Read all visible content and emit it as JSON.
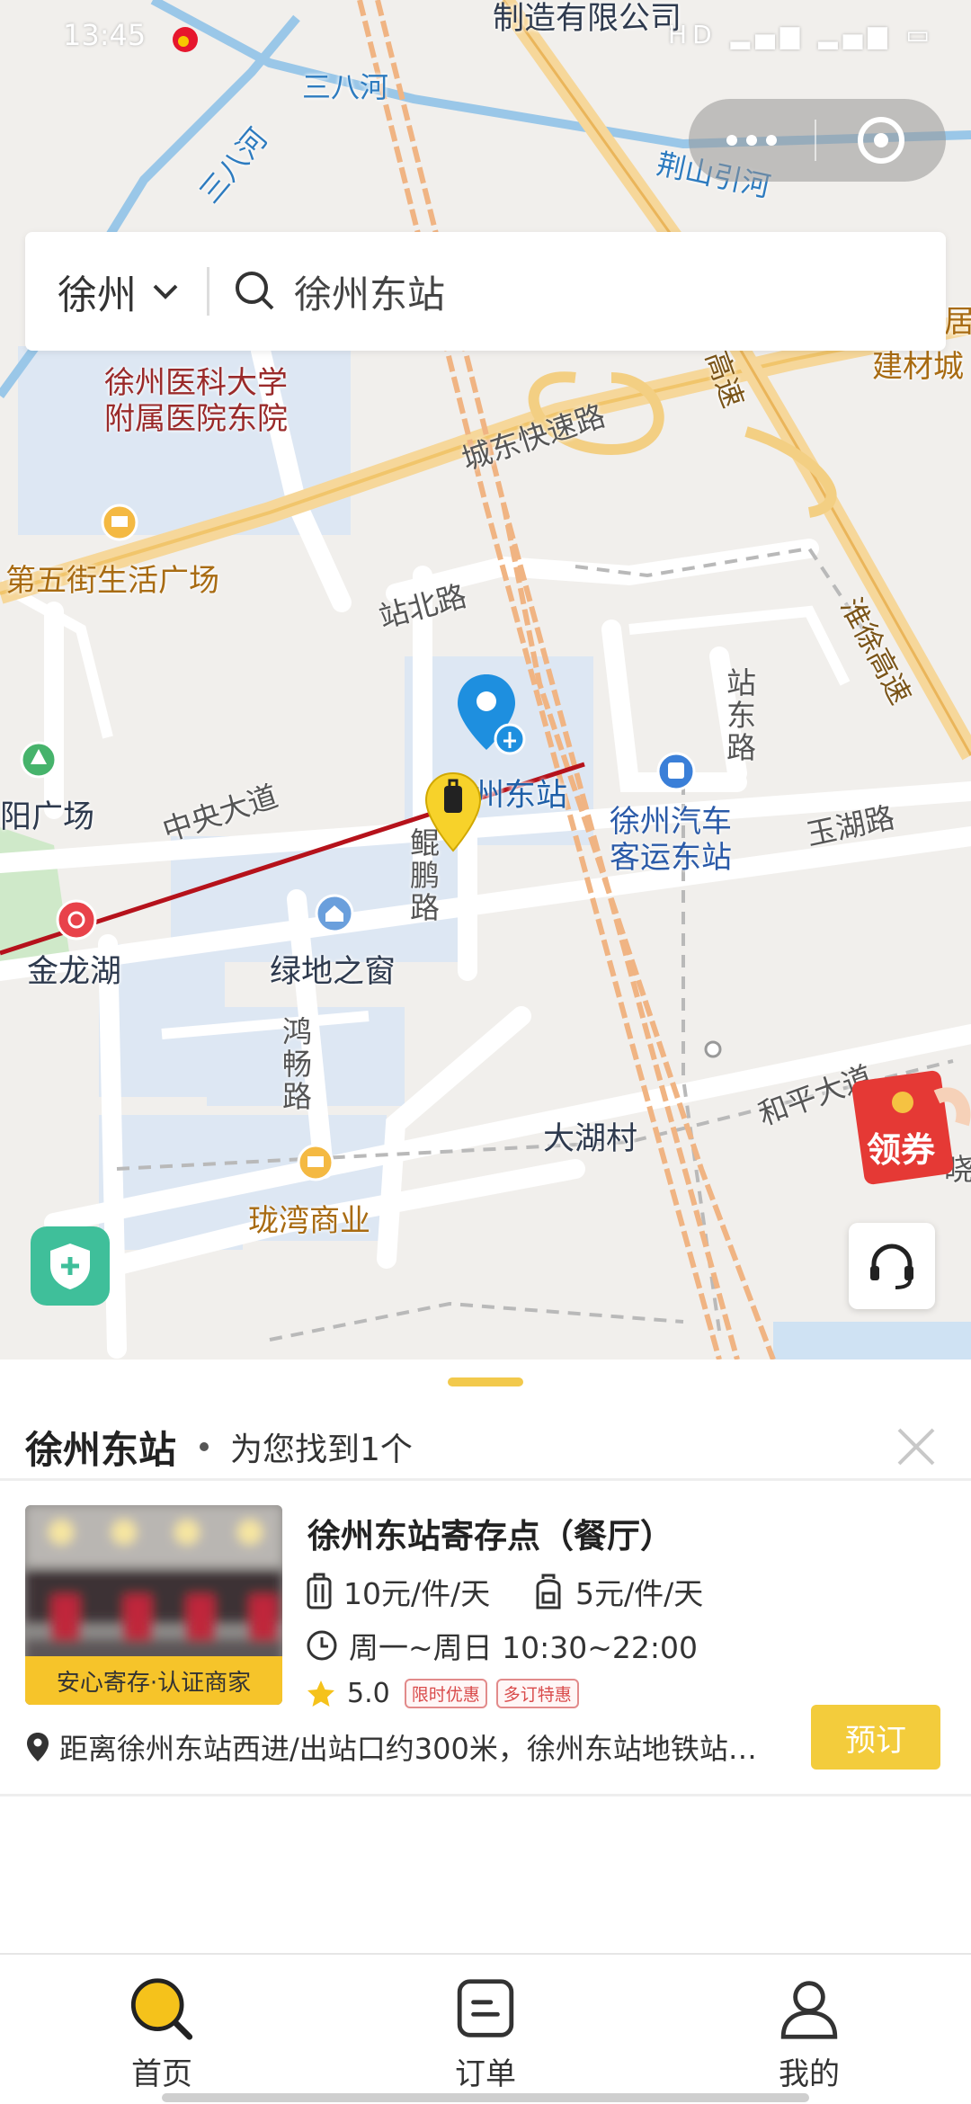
{
  "status_bar": {
    "time": "13:45",
    "icons": "HD ▂▄▆ ▂▄▆ ▭"
  },
  "map": {
    "labels": {
      "company": "制造有限公司",
      "river_sanba_1": "三八河",
      "river_sanba_2": "三八河",
      "river_jingshan": "荆山引河",
      "hospital": "徐州医科大学\n附属医院东院",
      "expressway_chengdong": "城东快速路",
      "building_city": "建材城",
      "fifth_avenue": "第五街生活广场",
      "zhanbei_road": "站北路",
      "huaixu_hwy": "淮徐高速",
      "zhandong_road": "站东路",
      "station": "州东站",
      "bus_station": "徐州汽车\n客运东站",
      "yuhu_road": "玉湖路",
      "zhongyang_avenue": "中央大道",
      "kunpeng_road": "鲲鹏路",
      "yang_square": "阳广场",
      "jinlong_lake": "金龙湖",
      "lvdi": "绿地之窗",
      "hongchang_road": "鸿畅路",
      "dahu_village": "大湖村",
      "heping_avenue": "和平大道",
      "longwan": "珑湾商业",
      "gaosu_edge": "高速",
      "xiao_edge": "晓",
      "ju_edge": "居"
    }
  },
  "capsule": {
    "more_icon": "more-dots-icon",
    "close_icon": "target-circle-icon"
  },
  "search": {
    "city": "徐州",
    "query": "徐州东站"
  },
  "floating": {
    "coupon_label": "领券",
    "safety_icon": "shield-plus-icon",
    "service_icon": "headset-icon"
  },
  "results": {
    "station_name": "徐州东站",
    "found_text": "为您找到1个",
    "items": [
      {
        "name": "徐州东站寄存点（餐厅）",
        "badge": "安心寄存·认证商家",
        "luggage_price": "10元/件/天",
        "backpack_price": "5元/件/天",
        "hours": "周一~周日 10:30~22:00",
        "rating": "5.0",
        "tags": [
          "限时优惠",
          "多订特惠"
        ],
        "address": "距离徐州东站西进/出站口约300米，徐州东站地铁站…",
        "book_label": "预订"
      }
    ]
  },
  "tabs": [
    {
      "label": "首页",
      "icon": "search-icon"
    },
    {
      "label": "订单",
      "icon": "order-icon"
    },
    {
      "label": "我的",
      "icon": "user-icon"
    }
  ],
  "colors": {
    "accent": "#f3cc3c",
    "brand_yellow": "#f6c42a",
    "map_bg": "#f1efec",
    "pin_blue": "#1e8fdf",
    "metro_red": "#b5121b"
  }
}
